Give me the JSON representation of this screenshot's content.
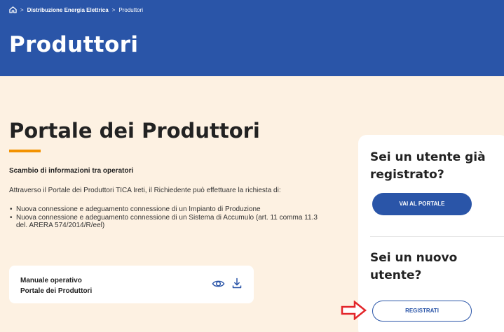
{
  "breadcrumb": {
    "home_icon": "home-icon",
    "items": [
      "Distribuzione Energia Elettrica",
      "Produttori"
    ]
  },
  "hero": {
    "title": "Produttori"
  },
  "section": {
    "title": "Portale dei Produttori",
    "subtitle": "Scambio di informazioni tra operatori",
    "intro": "Attraverso il Portale dei Produttori TICA Ireti, il Richiedente può effettuare la richiesta di:",
    "bullets": [
      "Nuova connessione e adeguamento connessione di un Impianto di Produzione",
      "Nuova connessione e adeguamento connessione di un Sistema di Accumulo (art. 11 comma 11.3 del. ARERA 574/2014/R/eel)"
    ]
  },
  "manual": {
    "title_line1": "Manuale operativo",
    "title_line2": "Portale dei Produttori",
    "view_icon": "eye-icon",
    "download_icon": "download-icon"
  },
  "sidebar": {
    "registered_heading": "Sei un utente già registrato?",
    "portal_button": "VAI AL PORTALE",
    "new_user_heading": "Sei un nuovo utente?",
    "register_button": "REGISTRATI"
  },
  "colors": {
    "brand_blue": "#2a55a8",
    "accent_orange": "#f39200",
    "page_bg": "#fdf1e2",
    "annotation_red": "#e3262a"
  }
}
